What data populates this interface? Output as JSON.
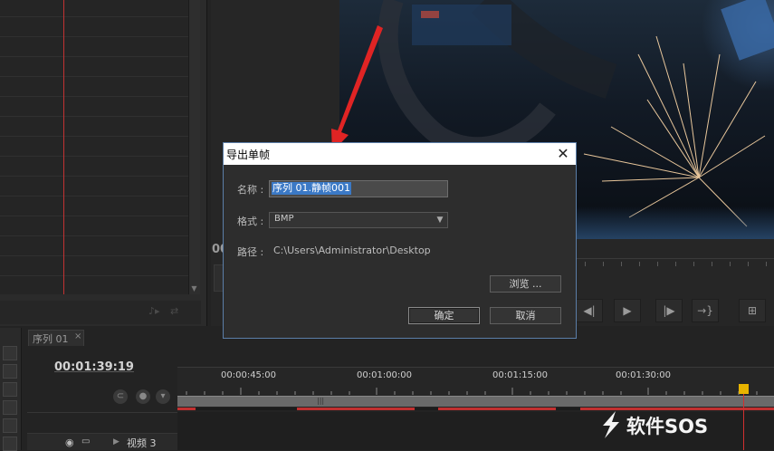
{
  "dialog": {
    "title": "导出单帧",
    "close_glyph": "✕",
    "name_label": "名称 :",
    "name_value": "序列 01.静帧001",
    "format_label": "格式 :",
    "format_value": "BMP",
    "path_label": "路径 :",
    "path_value": "C:\\Users\\Administrator\\Desktop",
    "browse_label": "浏览 ...",
    "ok_label": "确定",
    "cancel_label": "取消"
  },
  "monitor": {
    "timecode_partial": "00",
    "transport_glyphs": [
      "◀|",
      "▶",
      "|▶",
      "→}",
      "⊞"
    ]
  },
  "timeline": {
    "tab_label": "序列 01",
    "tab_close": "×",
    "timecode": "00:01:39:19",
    "ruler_labels": [
      "00:00:45:00",
      "00:01:00:00",
      "00:01:15:00",
      "00:01:30:00"
    ],
    "track_name": "视频 3"
  },
  "watermark": {
    "text": "软件SOS"
  },
  "colors": {
    "accent_blue": "#3b79c6",
    "playhead_red": "#c23232",
    "playhead_head": "#e8b400",
    "dialog_border": "#5b7ea8"
  },
  "icons": {
    "eye": "eye-icon",
    "film": "film-icon",
    "close": "close-icon",
    "dropdown": "chevron-down-icon",
    "arrow": "red-arrow-annotation"
  }
}
